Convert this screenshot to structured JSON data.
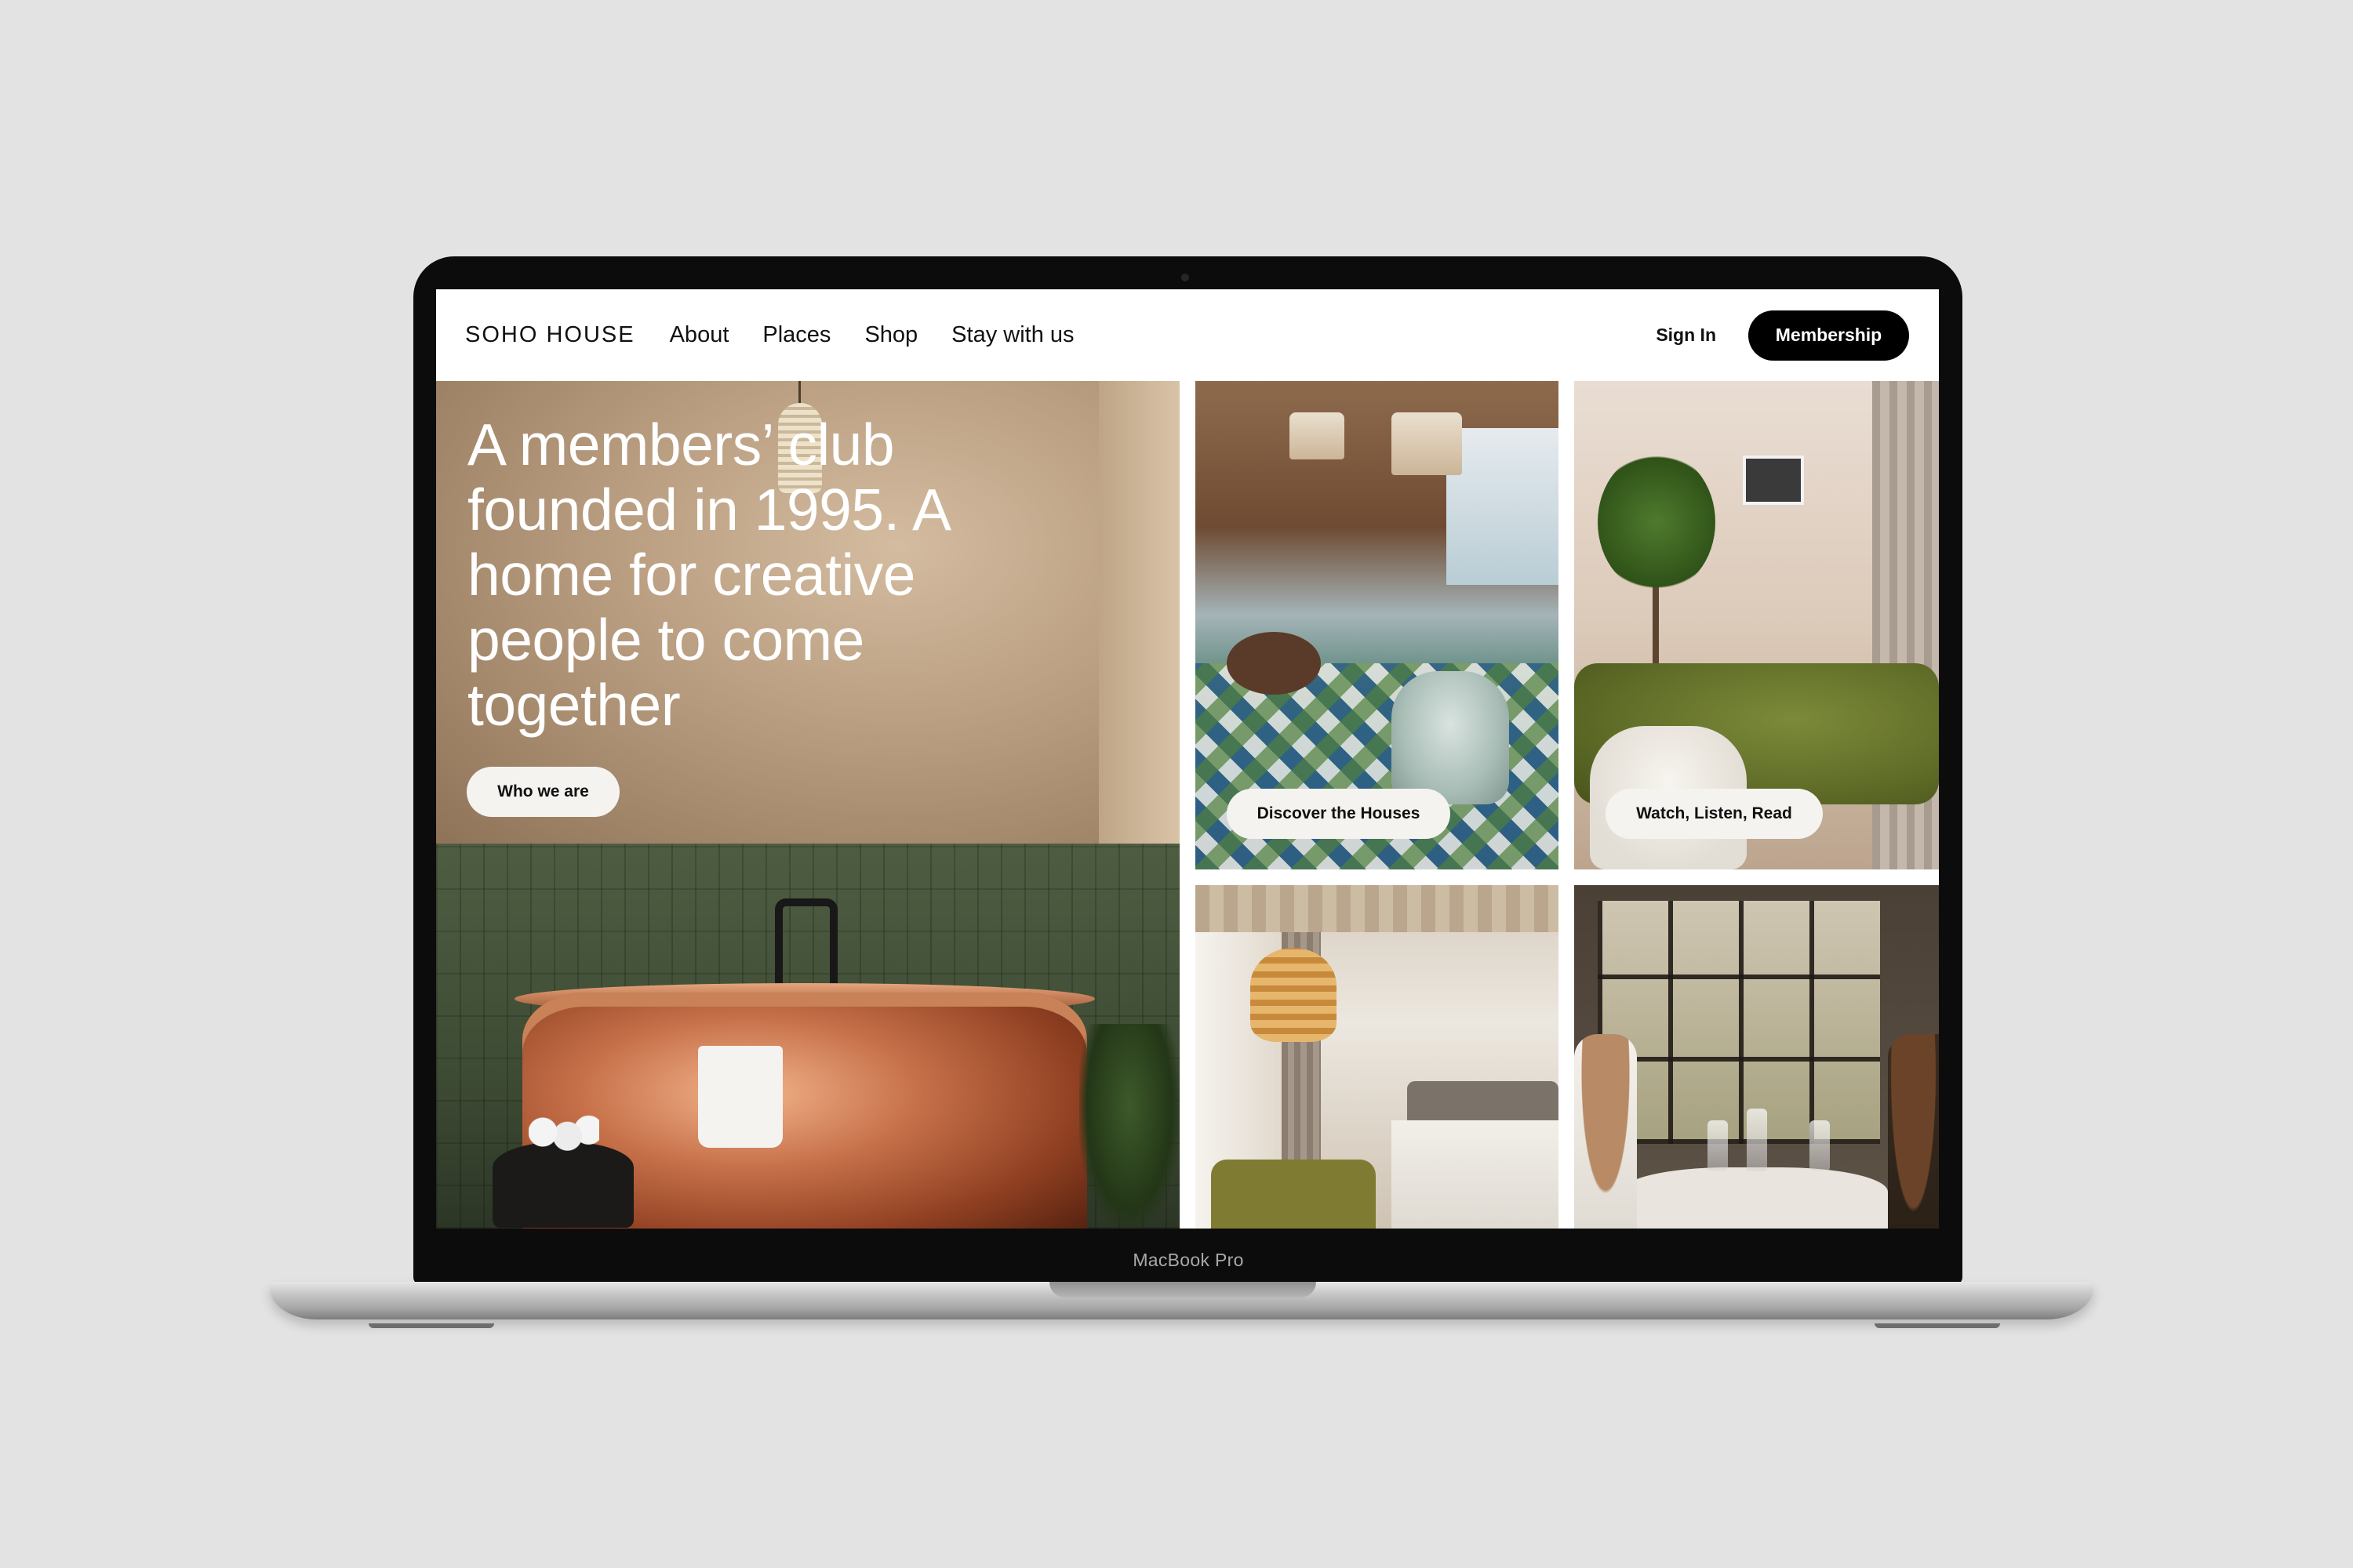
{
  "device": {
    "label": "MacBook Pro"
  },
  "nav": {
    "logo": "SOHO HOUSE",
    "links": [
      "About",
      "Places",
      "Shop",
      "Stay with us"
    ],
    "sign_in": "Sign In",
    "membership": "Membership"
  },
  "hero": {
    "heading": "A members’ club founded in 1995. A home for creative people to come together",
    "button": "Who we are"
  },
  "tiles": [
    {
      "button": "Discover the Houses"
    },
    {
      "button": "Watch, Listen, Read"
    }
  ],
  "colors": {
    "background": "#e3e3e3",
    "primary_button": "#000000",
    "pill_button": "#f5f3f0"
  }
}
